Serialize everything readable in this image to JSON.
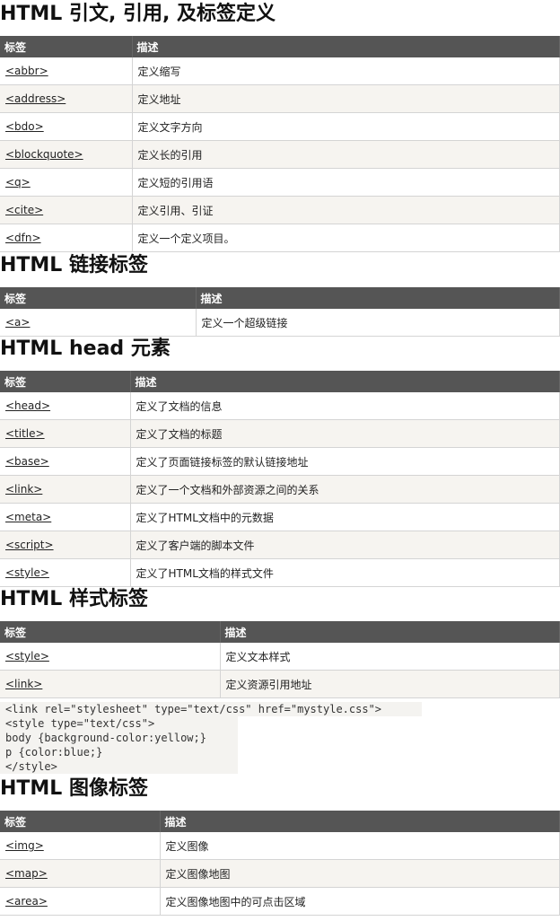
{
  "sections": [
    {
      "title": "HTML 引文, 引用, 及标签定义",
      "header": [
        "标签",
        "描述"
      ],
      "rows": [
        [
          "<abbr>",
          "定义缩写"
        ],
        [
          "<address>",
          "定义地址"
        ],
        [
          "<bdo>",
          "定义文字方向"
        ],
        [
          "<blockquote>",
          "定义长的引用"
        ],
        [
          "<q>",
          "定义短的引用语"
        ],
        [
          "<cite>",
          "定义引用、引证"
        ],
        [
          "<dfn>",
          "定义一个定义项目。"
        ]
      ]
    },
    {
      "title": "HTML 链接标签",
      "header": [
        "标签",
        "描述"
      ],
      "rows": [
        [
          "<a>",
          "定义一个超级链接"
        ]
      ]
    },
    {
      "title": "HTML head 元素",
      "header": [
        "标签",
        "描述"
      ],
      "rows": [
        [
          "<head>",
          "定义了文档的信息"
        ],
        [
          "<title>",
          "定义了文档的标题"
        ],
        [
          "<base>",
          "定义了页面链接标签的默认链接地址"
        ],
        [
          "<link>",
          "定义了一个文档和外部资源之间的关系"
        ],
        [
          "<meta>",
          "定义了HTML文档中的元数据"
        ],
        [
          "<script>",
          "定义了客户端的脚本文件"
        ],
        [
          "<style>",
          "定义了HTML文档的样式文件"
        ]
      ]
    },
    {
      "title": "HTML 样式标签",
      "header": [
        "标签",
        "描述"
      ],
      "rows": [
        [
          "<style>",
          "定义文本样式"
        ],
        [
          "<link>",
          "定义资源引用地址"
        ]
      ]
    },
    {
      "title": "HTML 图像标签",
      "header": [
        "标签",
        "描述"
      ],
      "rows": [
        [
          "<img>",
          "定义图像"
        ],
        [
          "<map>",
          "定义图像地图"
        ],
        [
          "<area>",
          "定义图像地图中的可点击区域"
        ]
      ]
    }
  ],
  "code": [
    "<link rel=\"stylesheet\" type=\"text/css\" href=\"mystyle.css\">",
    "<style type=\"text/css\">",
    "body {background-color:yellow;}",
    "p {color:blue;}",
    "</style>"
  ]
}
